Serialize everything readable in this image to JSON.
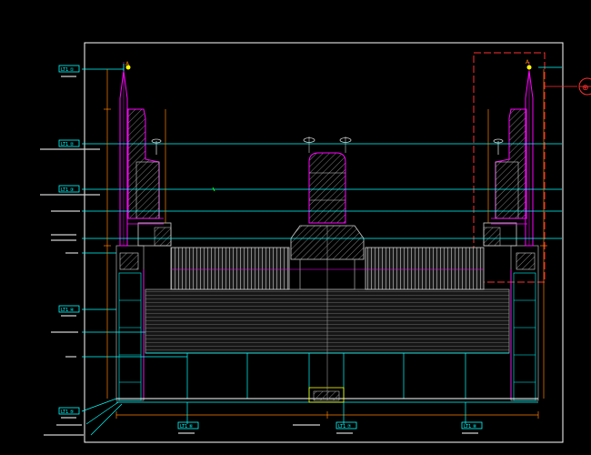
{
  "drawing": {
    "title": "",
    "background": "#000000",
    "colors": {
      "frame": "#ffffff",
      "magenta": "#ff00ff",
      "cyan": "#00ffff",
      "red": "#ff3030",
      "orange": "#ff8000",
      "yellow": "#ffff00",
      "grey": "#9a9a9a",
      "hatch": "#b0b0b0"
    },
    "tags": {
      "tag_l1": "LT1 ①",
      "tag_l2": "LT1 ②",
      "tag_l3": "LT1 ③",
      "tag_l4": "LT1 ④",
      "tag_l5": "LT1 ⑤",
      "tag_b1": "LT1 ⑥",
      "tag_b2": "LT1 ⑦",
      "tag_b3": "LT1 ⑧"
    },
    "marker_right": "⊕",
    "symbol_a": "A"
  }
}
